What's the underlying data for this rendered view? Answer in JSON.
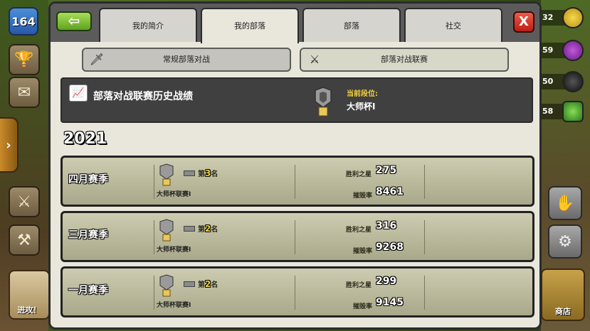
{
  "hud": {
    "level": "164",
    "attack_label": "进攻！",
    "shop_label": "商店",
    "resources": [
      "32",
      "59",
      "50",
      "58"
    ]
  },
  "tabs": [
    {
      "label": "我的简介"
    },
    {
      "label": "我的部落",
      "active": true
    },
    {
      "label": "部落"
    },
    {
      "label": "社交"
    }
  ],
  "close_label": "X",
  "back_label": "⇦",
  "subtabs": [
    {
      "label": "常规部落对战"
    },
    {
      "label": "部落对战联赛",
      "active": true
    }
  ],
  "history": {
    "title": "部落对战联赛历史战绩",
    "current_label": "当前段位:",
    "current_value": "大师杯I"
  },
  "year": "2021",
  "seasons": [
    {
      "name": "四月赛季",
      "rank_prefix": "第",
      "rank": "3",
      "rank_suffix": "名",
      "league": "大师杯联赛I",
      "stars_label": "胜利之星",
      "stars": "275",
      "destruction_label": "摧毁率",
      "destruction": "8461"
    },
    {
      "name": "三月赛季",
      "rank_prefix": "第",
      "rank": "2",
      "rank_suffix": "名",
      "league": "大师杯联赛I",
      "stars_label": "胜利之星",
      "stars": "316",
      "destruction_label": "摧毁率",
      "destruction": "9268"
    },
    {
      "name": "一月赛季",
      "rank_prefix": "第",
      "rank": "2",
      "rank_suffix": "名",
      "league": "大师杯联赛I",
      "stars_label": "胜利之星",
      "stars": "299",
      "destruction_label": "摧毁率",
      "destruction": "9145"
    }
  ]
}
